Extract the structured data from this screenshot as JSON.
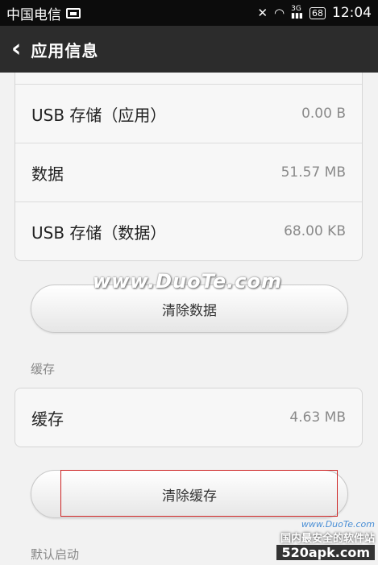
{
  "status_bar": {
    "carrier": "中国电信",
    "network": "3G",
    "battery": "68",
    "time": "12:04"
  },
  "header": {
    "title": "应用信息"
  },
  "storage_rows": [
    {
      "label": "USB 存储（应用）",
      "value": "0.00 B"
    },
    {
      "label": "数据",
      "value": "51.57 MB"
    },
    {
      "label": "USB 存储（数据）",
      "value": "68.00 KB"
    }
  ],
  "buttons": {
    "clear_data": "清除数据",
    "clear_cache": "清除缓存"
  },
  "cache_section": {
    "title": "缓存",
    "row_label": "缓存",
    "row_value": "4.63 MB"
  },
  "default_launch_section": {
    "title": "默认启动"
  },
  "watermarks": {
    "center": "www.DuoTe.com",
    "corner_small": "www.DuoTe.com",
    "corner_tagline": "国内最安全的软件站",
    "corner_site": "520apk.com"
  }
}
